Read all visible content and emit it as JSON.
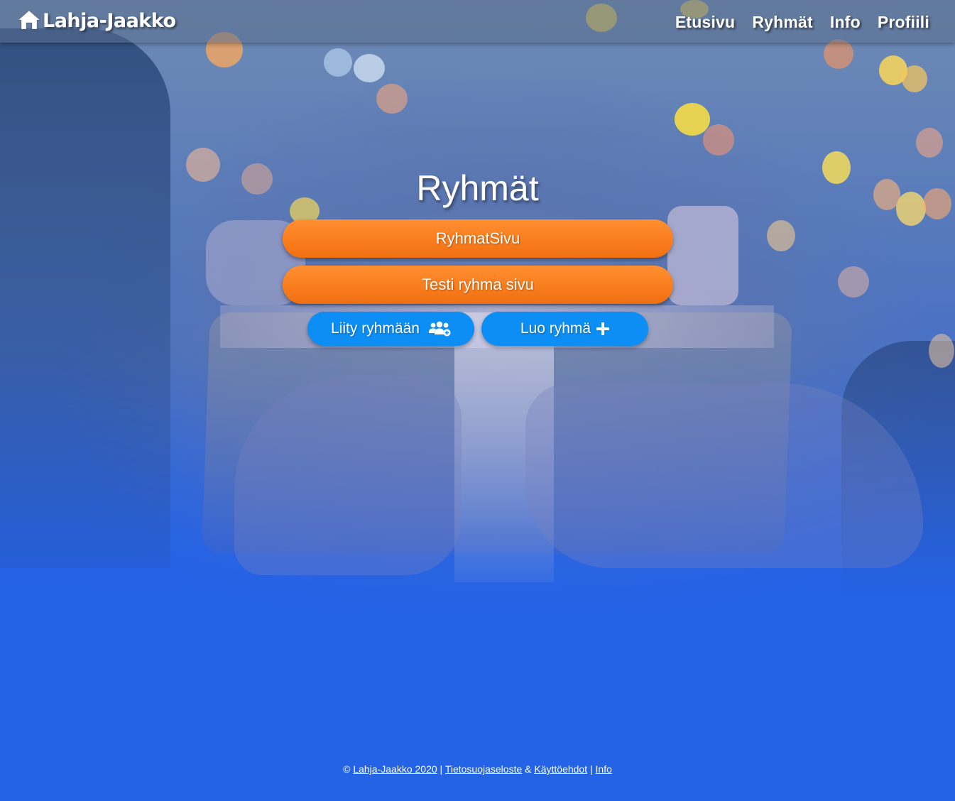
{
  "navbar": {
    "brand": "Lahja-Jaakko",
    "brand_icon": "home-icon",
    "links": [
      "Etusivu",
      "Ryhmät",
      "Info",
      "Profiili"
    ]
  },
  "main": {
    "title": "Ryhmät",
    "groups": [
      "RyhmatSivu",
      "Testi ryhma sivu"
    ],
    "join_button": {
      "label": "Liity ryhmään",
      "icon": "users-plus-icon"
    },
    "create_button": {
      "label": "Luo ryhmä",
      "icon": "plus-icon"
    }
  },
  "footer": {
    "copyright_symbol": "©",
    "brand_link": "Lahja-Jaakko 2020",
    "separator1": "|",
    "privacy_link": "Tietosuojaseloste",
    "ampersand": "&",
    "terms_link": "Käyttöehdot",
    "separator2": "|",
    "info_link": "Info"
  },
  "colors": {
    "background": "#2462e6",
    "group_button": "#f97c1c",
    "action_button": "#0d8ef5"
  }
}
